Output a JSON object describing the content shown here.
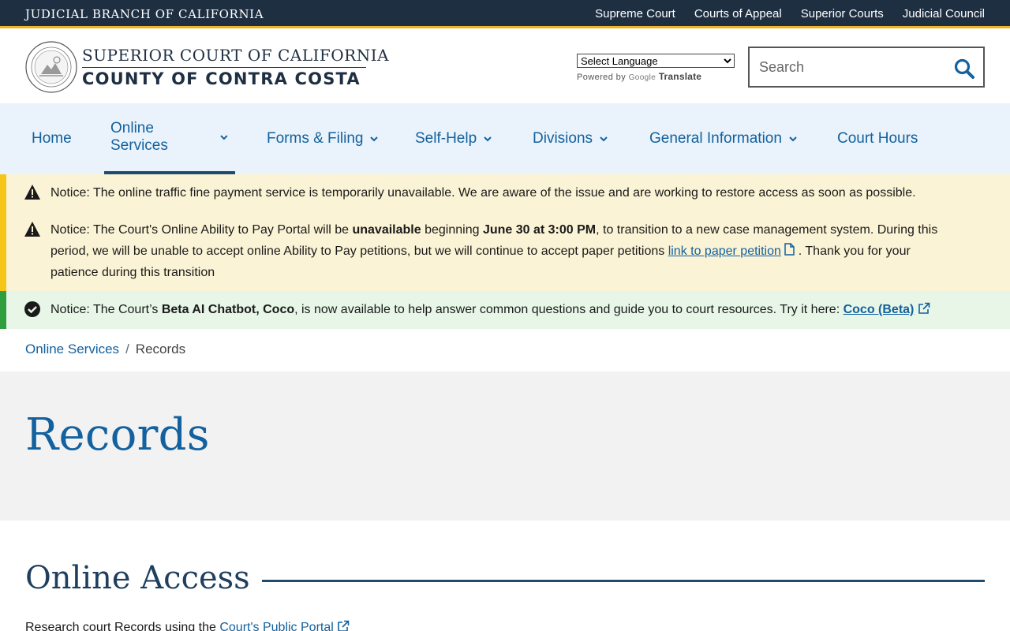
{
  "topbar": {
    "brand": "JUDICIAL BRANCH OF CALIFORNIA",
    "links": [
      "Supreme Court",
      "Courts of Appeal",
      "Superior Courts",
      "Judicial Council"
    ]
  },
  "header": {
    "title_line1": "SUPERIOR COURT OF CALIFORNIA",
    "title_line2": "COUNTY OF CONTRA COSTA",
    "language_select": "Select Language",
    "powered_by": "Powered by",
    "google": "Google",
    "translate": "Translate",
    "search_placeholder": "Search"
  },
  "nav": {
    "items": [
      {
        "label": "Home",
        "dropdown": false
      },
      {
        "label": "Online Services",
        "dropdown": true,
        "active": true
      },
      {
        "label": "Forms & Filing",
        "dropdown": true
      },
      {
        "label": "Self-Help",
        "dropdown": true
      },
      {
        "label": "Divisions",
        "dropdown": true
      },
      {
        "label": "General Information",
        "dropdown": true
      },
      {
        "label": "Court Hours",
        "dropdown": false
      }
    ]
  },
  "notices": {
    "n1": {
      "text": "Notice: The online traffic fine payment service is temporarily unavailable. We are aware of the issue and are working to restore access as soon as possible."
    },
    "n2": {
      "part1": "Notice: The Court's Online Ability to Pay Portal will be ",
      "bold1": "unavailable",
      "part2": " beginning ",
      "bold2": "June 30 at 3:00 PM",
      "part3": ", to transition to a new case management system. During this period, we will be unable to accept online Ability to Pay petitions, but we will continue to accept paper petitions ",
      "link": "link to paper petition",
      "part4": " . Thank you for your patience during this transition"
    },
    "n3": {
      "part1": "Notice: The Court’s ",
      "bold1": "Beta AI Chatbot, Coco",
      "part2": ", is now available to help answer common questions and guide you to court resources. Try it here: ",
      "link": "Coco (Beta)"
    }
  },
  "breadcrumb": {
    "parent": "Online Services",
    "current": "Records"
  },
  "hero": {
    "title": "Records"
  },
  "section": {
    "title": "Online Access",
    "para_prefix": "Research court Records using the ",
    "para_link": "Court's Public Portal"
  },
  "colors": {
    "topbar": "#1f2f42",
    "accent_gold": "#f0b323",
    "link_blue": "#13619e",
    "nav_bg": "#eaf3fb",
    "warn_bg": "#fbf3d5",
    "ok_bg": "#e7f6e7"
  },
  "icons": {
    "search": "search-icon",
    "warning": "warning-icon",
    "check": "check-circle-icon",
    "external": "external-link-icon",
    "document": "document-icon"
  }
}
